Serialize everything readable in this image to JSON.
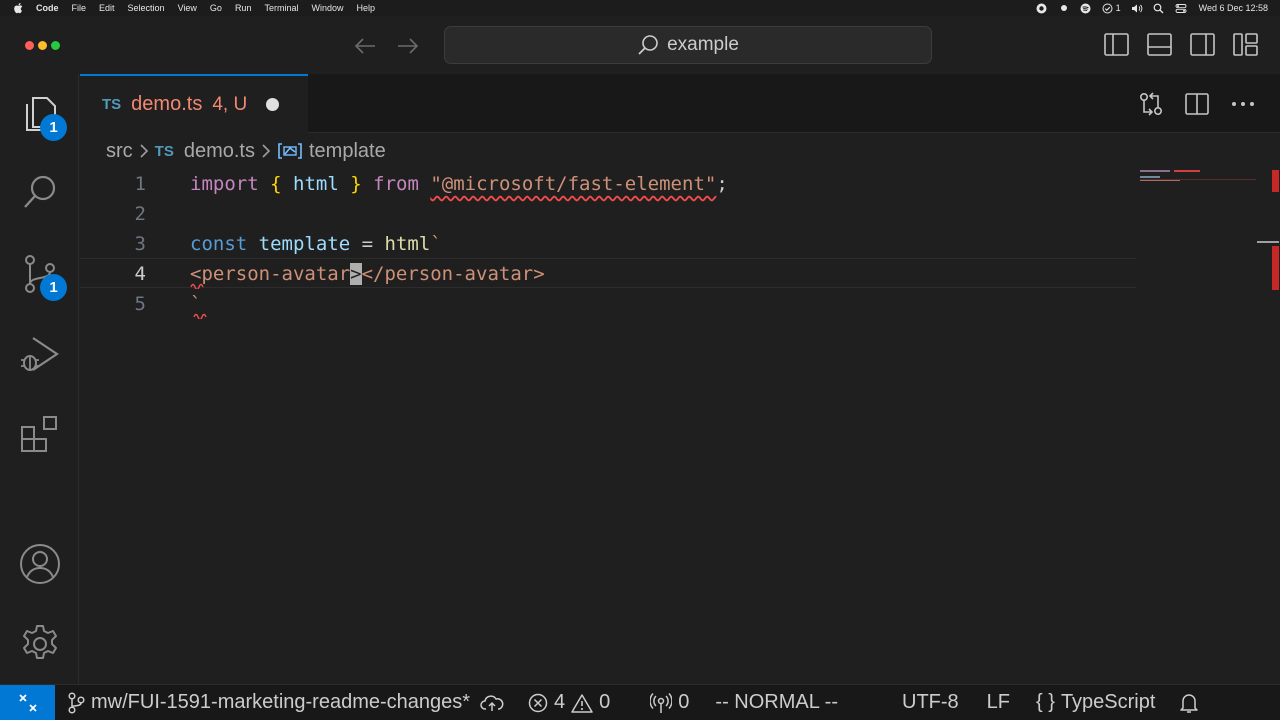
{
  "menubar": {
    "app_name": "Code",
    "items": [
      "File",
      "Edit",
      "Selection",
      "View",
      "Go",
      "Run",
      "Terminal",
      "Window",
      "Help"
    ],
    "notif_count": "1",
    "clock": "Wed 6 Dec  12:58"
  },
  "titlebar": {
    "search_text": "example"
  },
  "activitybar": {
    "explorer_badge": "1",
    "scm_badge": "1"
  },
  "tab": {
    "icon_text": "TS",
    "label": "demo.ts",
    "meta": "4, U"
  },
  "breadcrumb": {
    "folder": "src",
    "file_icon_text": "TS",
    "file": "demo.ts",
    "symbol": "template"
  },
  "editor": {
    "line_numbers": [
      "1",
      "2",
      "3",
      "4",
      "5"
    ],
    "line1": {
      "kw": "import",
      "open": "{",
      "name": "html",
      "close": "}",
      "from": "from",
      "module": "\"@microsoft/fast-element\"",
      "semi": ";"
    },
    "line3": {
      "kw": "const",
      "name": "template",
      "eq": "=",
      "fn": "html",
      "tick": "`"
    },
    "line4": {
      "open_tag": "<person-avatar",
      "cursor_char": ">",
      "close_tag": "</person-avatar>"
    },
    "line5": {
      "tick": "`"
    }
  },
  "statusbar": {
    "branch": "mw/FUI-1591-marketing-readme-changes*",
    "errors": "4",
    "warnings": "0",
    "ports": "0",
    "mode": "-- NORMAL --",
    "encoding": "UTF-8",
    "eol": "LF",
    "language_icon_text": "{ }",
    "language": "TypeScript"
  }
}
